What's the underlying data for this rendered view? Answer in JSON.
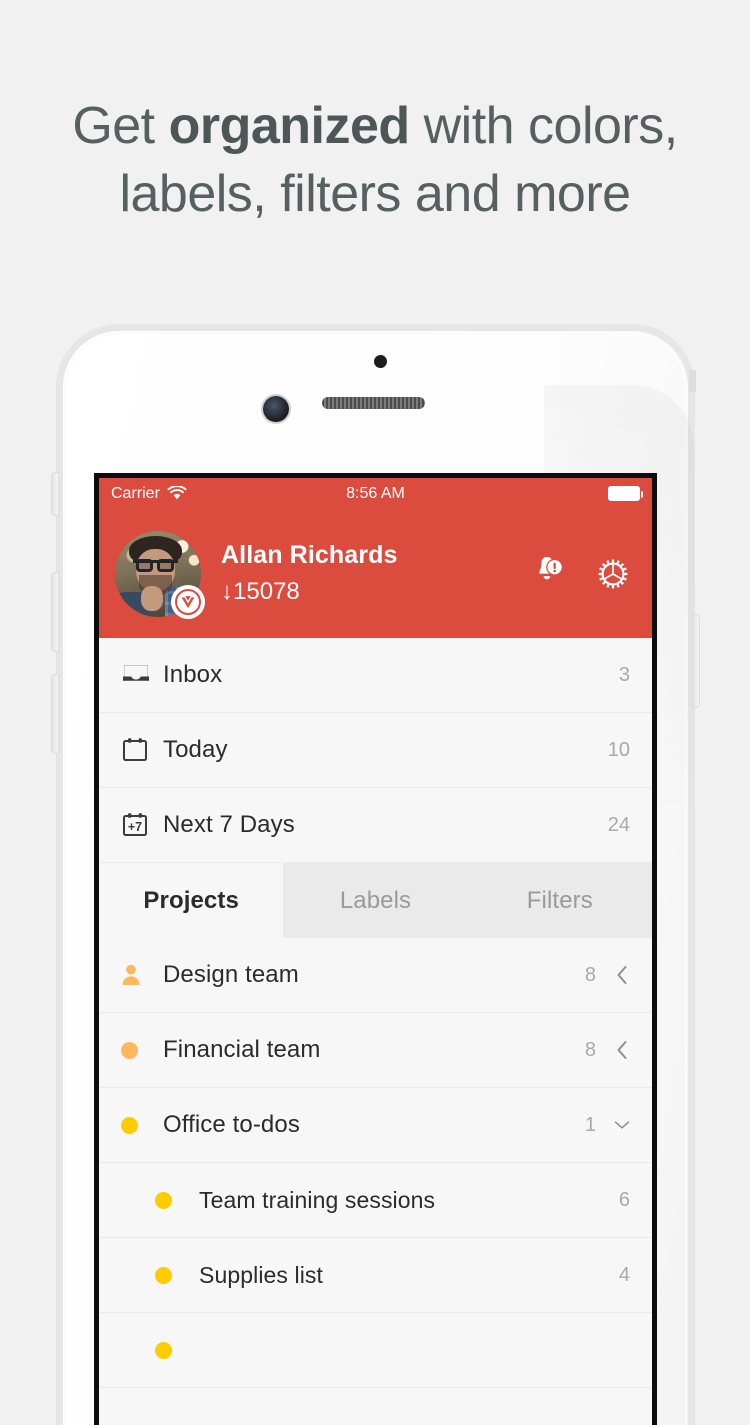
{
  "headline": {
    "line1_pre": "Get ",
    "line1_bold": "organized",
    "line1_post": " with colors,",
    "line2": "labels, filters and more"
  },
  "colors": {
    "brand_red": "#db4c3f",
    "screen_bg": "#f7f7f7",
    "page_bg": "#f1f1f1",
    "orange": "#fcb75f",
    "yellow": "#ffcc00",
    "muted_text": "#a9a9a9"
  },
  "status_bar": {
    "carrier": "Carrier",
    "wifi_icon": "wifi-icon",
    "time": "8:56 AM",
    "battery_icon": "battery-full-icon"
  },
  "header": {
    "avatar_icon": "avatar",
    "karma_badge_icon": "todoist-karma-badge-icon",
    "user_name": "Allan Richards",
    "karma": "↓15078",
    "notifications_icon": "bell-alert-icon",
    "settings_icon": "gear-icon"
  },
  "nav": [
    {
      "label": "Inbox",
      "count": "3",
      "icon": "inbox-icon"
    },
    {
      "label": "Today",
      "count": "10",
      "icon": "calendar-icon"
    },
    {
      "label": "Next 7 Days",
      "count": "24",
      "icon": "calendar-next-7-days-icon"
    }
  ],
  "tabs": [
    {
      "label": "Projects",
      "active": true
    },
    {
      "label": "Labels",
      "active": false
    },
    {
      "label": "Filters",
      "active": false
    }
  ],
  "projects": [
    {
      "label": "Design team",
      "count": "8",
      "icon": "shared-project-person-icon",
      "color": "#fcb75f",
      "chevron": "chevron-left-icon",
      "sub": false
    },
    {
      "label": "Financial team",
      "count": "8",
      "icon": "project-dot-icon",
      "color": "#fcb75f",
      "chevron": "chevron-left-icon",
      "sub": false
    },
    {
      "label": "Office to-dos",
      "count": "1",
      "icon": "project-dot-icon",
      "color": "#ffcc00",
      "chevron": "chevron-down-icon",
      "sub": false
    },
    {
      "label": "Team training sessions",
      "count": "6",
      "icon": "project-dot-icon",
      "color": "#ffcc00",
      "chevron": "",
      "sub": true
    },
    {
      "label": "Supplies list",
      "count": "4",
      "icon": "project-dot-icon",
      "color": "#ffcc00",
      "chevron": "",
      "sub": true
    }
  ],
  "device": {
    "sensor_icon": "proximity-sensor",
    "camera_icon": "front-camera",
    "speaker_icon": "earpiece-speaker",
    "silent_switch": "ring-silent-switch",
    "volume_up": "volume-up-button",
    "volume_down": "volume-down-button",
    "power": "power-button"
  }
}
